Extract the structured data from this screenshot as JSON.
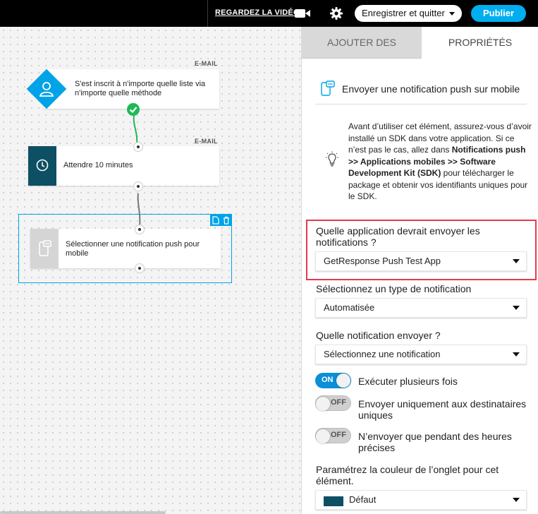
{
  "topbar": {
    "watch_video": "REGARDEZ LA VIDÉO",
    "save_and_quit": "Enregistrer et quitter",
    "publish": "Publier",
    "icons": [
      "video-camera-icon",
      "gear-icon",
      "chevron-down-icon"
    ]
  },
  "canvas": {
    "nodes": [
      {
        "tag": "E-MAIL",
        "text": "S'est inscrit à n'importe quelle liste via n'importe quelle méthode",
        "icon": "user-icon"
      },
      {
        "tag": "E-MAIL",
        "text": "Attendre 10 minutes",
        "icon": "clock-icon"
      },
      {
        "tag": "",
        "text": "Sélectionner une notification push pour mobile",
        "icon": "mobile-push-icon"
      }
    ],
    "frame_tools": [
      "document-icon",
      "trash-icon"
    ]
  },
  "panel": {
    "tabs": {
      "add": "AJOUTER DES",
      "properties": "PROPRIÉTÉS"
    },
    "title": "Envoyer une notification push sur mobile",
    "info": {
      "p1": "Avant d’utiliser cet élément, assurez-vous d’avoir installé un SDK dans votre application. Si ce n’est pas le cas, allez dans ",
      "path": "Notifications push >> Applications mobiles >> Software Development Kit (SDK)",
      "p2": " pour télécharger le package et obtenir vos identifiants uniques pour le SDK."
    },
    "app_field": {
      "label": "Quelle application devrait envoyer les notifications ?",
      "value": "GetResponse Push Test App"
    },
    "type_field": {
      "label": "Sélectionnez un type de notification",
      "value": "Automatisée"
    },
    "notif_field": {
      "label": "Quelle notification envoyer ?",
      "value": "Sélectionnez une notification"
    },
    "toggles": [
      {
        "state": "ON",
        "label": "Exécuter plusieurs fois"
      },
      {
        "state": "OFF",
        "label": "Envoyer uniquement aux destinataires uniques"
      },
      {
        "state": "OFF",
        "label": "N’envoyer que pendant des heures précises"
      }
    ],
    "color_field": {
      "label": "Paramétrez la couleur de l’onglet pour cet élément.",
      "value": "Défaut",
      "swatch": "#0d4f63"
    }
  },
  "colors": {
    "accent": "#00a2e8",
    "publish": "#00aef0",
    "toggle_on": "#0b8fd6",
    "highlight": "#e23b4c",
    "success": "#1fb856",
    "dark_teal": "#0d4f63"
  }
}
